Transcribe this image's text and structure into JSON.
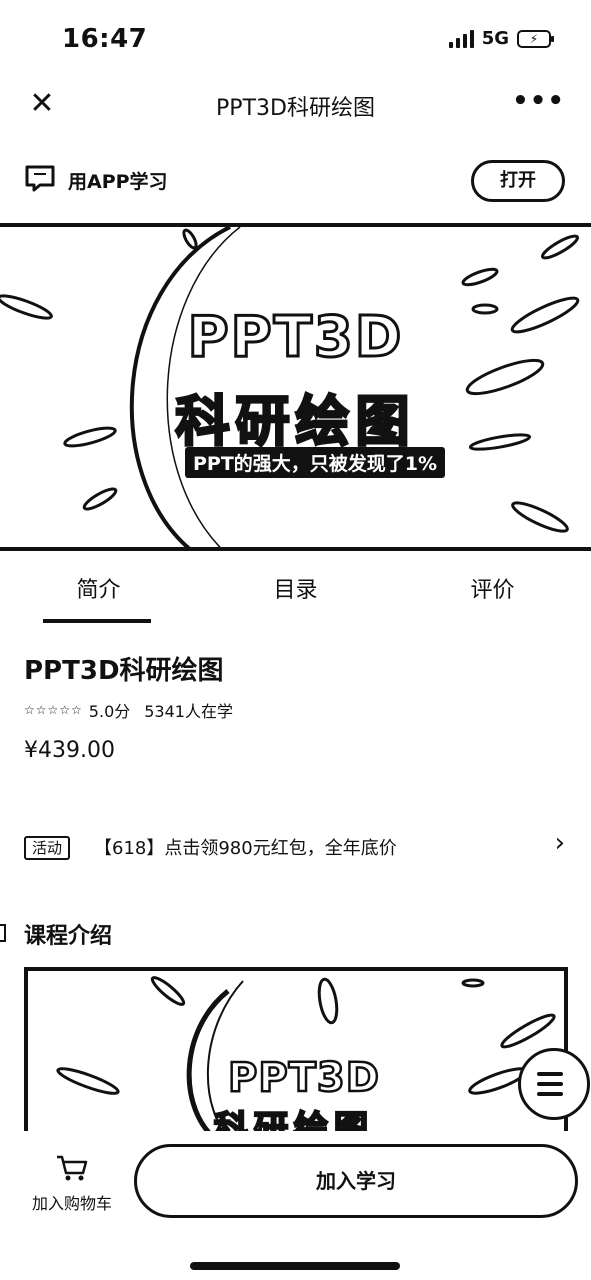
{
  "status": {
    "time": "16:47",
    "network": "5G"
  },
  "nav": {
    "close_icon": "close-icon",
    "title": "PPT3D科研绘图",
    "more_icon": "more-icon"
  },
  "app_bar": {
    "label": "用APP学习",
    "open_label": "打开"
  },
  "banner": {
    "title": "PPT3D",
    "subtitle": "科研绘图",
    "tagline": "PPT的强大，只被发现了1%"
  },
  "tabs": [
    {
      "label": "简介"
    },
    {
      "label": "目录"
    },
    {
      "label": "评价"
    }
  ],
  "course": {
    "title": "PPT3D科研绘图",
    "stars": "☆☆☆☆☆",
    "score": "5.0分",
    "learners": "5341人在学",
    "price": "¥439.00"
  },
  "promo": {
    "badge": "活动",
    "text": "【618】点击领980元红包，全年底价",
    "arrow": "›"
  },
  "section": {
    "title": "课程介绍"
  },
  "preview": {
    "title": "PPT3D",
    "subtitle": "科研绘图"
  },
  "bottom": {
    "cart_label": "加入购物车",
    "join_label": "加入学习"
  }
}
